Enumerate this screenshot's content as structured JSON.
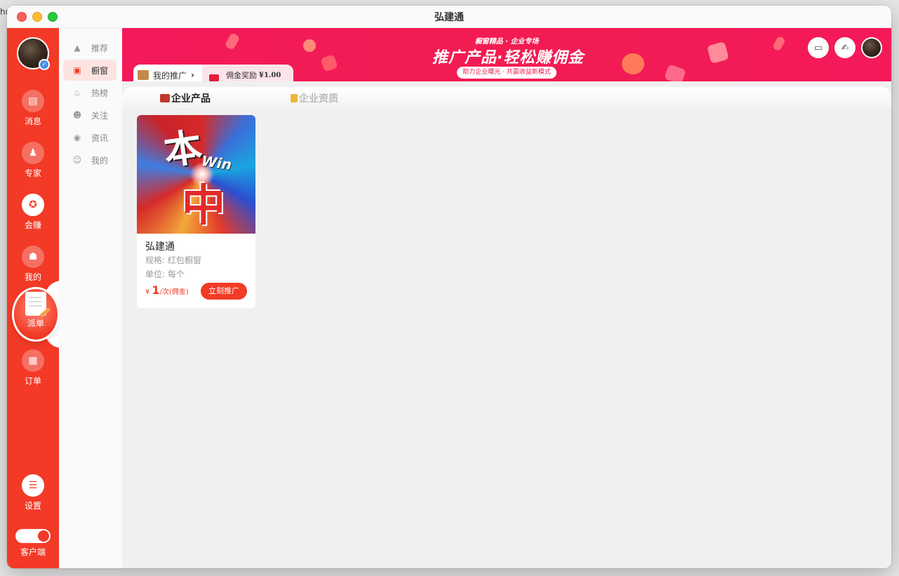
{
  "window": {
    "title": "弘建通"
  },
  "desktop": {
    "peek_text": "hu"
  },
  "rail": {
    "items": [
      {
        "label": "消息",
        "icon": "message-icon",
        "glyph": "▤"
      },
      {
        "label": "专家",
        "icon": "expert-icon",
        "glyph": "♟"
      },
      {
        "label": "会赚",
        "icon": "earn-icon",
        "glyph": "✪"
      },
      {
        "label": "我的",
        "icon": "profile-icon",
        "glyph": "☗"
      },
      {
        "label": "派单",
        "icon": "dispatch-icon"
      },
      {
        "label": "订单",
        "icon": "order-icon",
        "glyph": "▦"
      }
    ],
    "settings_label": "设置",
    "client_label": "客户端",
    "active": "会赚",
    "accent_color": "#f23a26"
  },
  "subnav": {
    "items": [
      {
        "label": "推荐",
        "icon": "thumbs-up-icon",
        "glyph": "👍"
      },
      {
        "label": "橱窗",
        "icon": "storefront-icon",
        "glyph": "▣"
      },
      {
        "label": "热榜",
        "icon": "flame-icon",
        "glyph": "♨"
      },
      {
        "label": "关注",
        "icon": "follow-icon",
        "glyph": "☻"
      },
      {
        "label": "资讯",
        "icon": "broadcast-icon",
        "glyph": "◉"
      },
      {
        "label": "我的",
        "icon": "user-icon",
        "glyph": "☺"
      }
    ],
    "active": "橱窗"
  },
  "banner": {
    "kicker": "橱窗精品 · 企业专场",
    "headline": "推广产品·轻松赚佣金",
    "pill": "助力企业曝光 · 共赢收益新模式",
    "color": "#f41a5a"
  },
  "promo": {
    "my_promo_label": "我的推广",
    "reward_label": "佣金奖励",
    "reward_amount": "¥1.00"
  },
  "tabs": [
    {
      "label": "企业产品",
      "icon": "briefcase-icon",
      "active": true
    },
    {
      "label": "企业资质",
      "icon": "medal-icon",
      "active": false
    }
  ],
  "products": [
    {
      "name": "弘建通",
      "spec": "规格: 红包橱窗",
      "unit": "单位: 每个",
      "currency": "¥",
      "price": "1",
      "price_unit": "/次(佣金)",
      "button_label": "立刻推广",
      "image_text_1": "本",
      "image_text_2": "Win",
      "image_text_3": "中"
    }
  ]
}
